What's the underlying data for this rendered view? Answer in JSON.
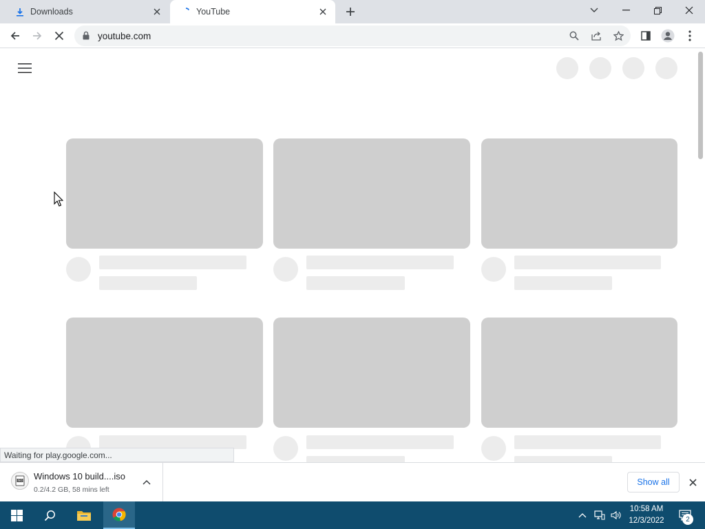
{
  "tabs": [
    {
      "title": "Downloads",
      "icon": "download-icon",
      "active": false
    },
    {
      "title": "YouTube",
      "icon": "loading-spinner-icon",
      "active": true
    }
  ],
  "toolbar": {
    "url": "youtube.com",
    "reload_state": "loading"
  },
  "page": {
    "status_text": "Waiting for play.google.com...",
    "skeleton_cards_visible": 6
  },
  "download": {
    "filename": "Windows 10 build....iso",
    "progress_text": "0.2/4.2 GB, 58 mins left",
    "show_all_label": "Show all"
  },
  "taskbar": {
    "time": "10:58 AM",
    "date": "12/3/2022",
    "notification_count": "2"
  },
  "colors": {
    "tabstrip": "#dee1e6",
    "skeleton_thumb": "#cfcfcf",
    "skeleton_line": "#ececec",
    "link_blue": "#1a73e8",
    "taskbar": "#0f4c6e"
  }
}
